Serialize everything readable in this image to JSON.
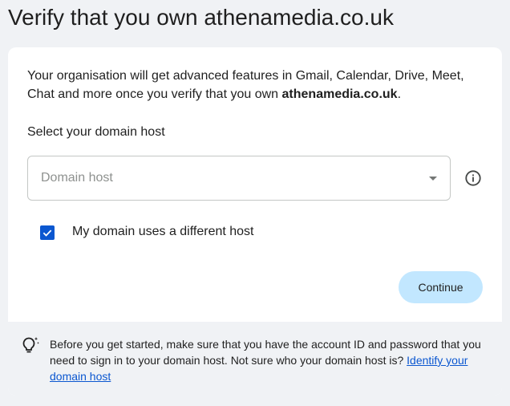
{
  "page": {
    "title": "Verify that you own athenamedia.co.uk"
  },
  "intro": {
    "text_before": "Your organisation will get advanced features in Gmail, Calendar, Drive, Meet, Chat and more once you verify that you own ",
    "domain": "athenamedia.co.uk",
    "text_after": "."
  },
  "domain_host": {
    "label": "Select your domain host",
    "placeholder": "Domain host",
    "selected_value": ""
  },
  "different_host": {
    "label": "My domain uses a different host",
    "checked": true
  },
  "actions": {
    "continue_label": "Continue"
  },
  "tip": {
    "text": "Before you get started, make sure that you have the account ID and password that you need to sign in to your domain host. Not sure who your domain host is? ",
    "link_label": "Identify your domain host"
  },
  "colors": {
    "accent": "#0b57d0",
    "button_bg": "#c2e7ff",
    "page_bg": "#f0f2f5"
  },
  "icons": {
    "info": "info-icon",
    "dropdown": "chevron-down-icon",
    "checkbox": "checkmark-icon",
    "tip": "lightbulb-icon"
  }
}
